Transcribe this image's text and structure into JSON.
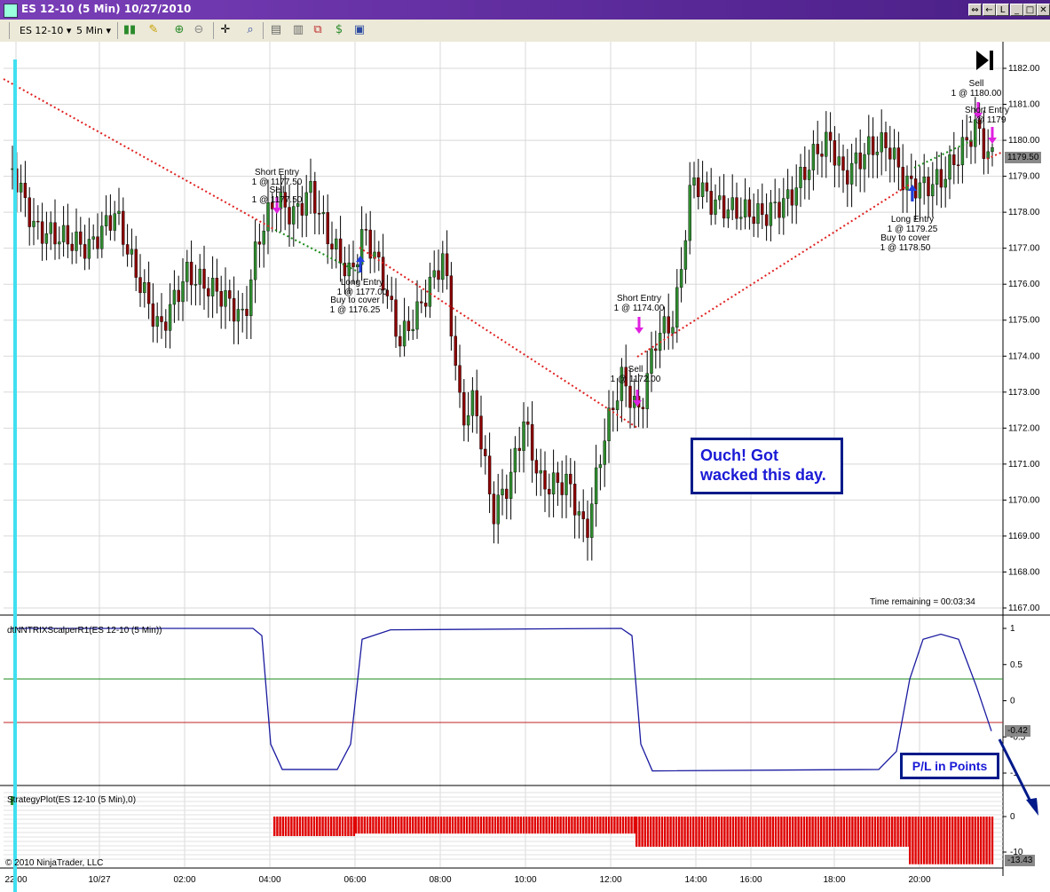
{
  "window": {
    "title": "ES 12-10 (5 Min)  10/27/2010"
  },
  "toolbar": {
    "instrument": "ES 12-10",
    "interval": "5 Min"
  },
  "chart": {
    "price_ticks": [
      "1182.00",
      "1181.00",
      "1180.00",
      "1179.00",
      "1178.00",
      "1177.00",
      "1176.00",
      "1175.00",
      "1174.00",
      "1173.00",
      "1172.00",
      "1171.00",
      "1170.00",
      "1169.00",
      "1168.00",
      "1167.00"
    ],
    "last_price": "1179.50",
    "time_ticks": [
      "22:00",
      "10/27",
      "02:00",
      "04:00",
      "06:00",
      "08:00",
      "10:00",
      "12:00",
      "14:00",
      "16:00",
      "18:00",
      "20:00"
    ],
    "time_remaining": "Time remaining = 00:03:34",
    "trades": [
      {
        "label1": "Short Entry",
        "label2": "1 @ 1177.50"
      },
      {
        "label1": "Sell",
        "label2": "1 @ 1177.50"
      },
      {
        "label1": "Long Entry",
        "label2": "1 @ 1177.00"
      },
      {
        "label1": "Buy to cover",
        "label2": "1 @ 1176.25"
      },
      {
        "label1": "Short Entry",
        "label2": "1 @ 1174.00"
      },
      {
        "label1": "Sell",
        "label2": "1 @ 1172.00"
      },
      {
        "label1": "Long Entry",
        "label2": "1 @ 1179.25"
      },
      {
        "label1": "Buy to cover",
        "label2": "1 @ 1178.50"
      },
      {
        "label1": "Sell",
        "label2": "1 @ 1180.00"
      },
      {
        "label1": "Short Entry",
        "label2": "1 @ 1179"
      }
    ]
  },
  "indicator": {
    "label": "dtNNTRIXScalperR1(ES 12-10 (5 Min))",
    "ticks": [
      "1",
      "0.5",
      "0",
      "-0.5",
      "-1"
    ],
    "last_value": "-0.42"
  },
  "strategy_plot": {
    "label": "StrategyPlot(ES 12-10 (5 Min),0)",
    "ticks": [
      "0",
      "-10"
    ],
    "last_value": "-13.43"
  },
  "annotations": {
    "ouch": "Ouch!  Got wacked this day.",
    "pl": "P/L in Points"
  },
  "copyright": "© 2010 NinjaTrader, LLC",
  "colors": {
    "title_bar": "#5b2a9a",
    "up_candle": "#2e8b2e",
    "down_candle": "#8b0000",
    "pl_bars": "#e00000",
    "cursor_line": "#40e0f0"
  }
}
